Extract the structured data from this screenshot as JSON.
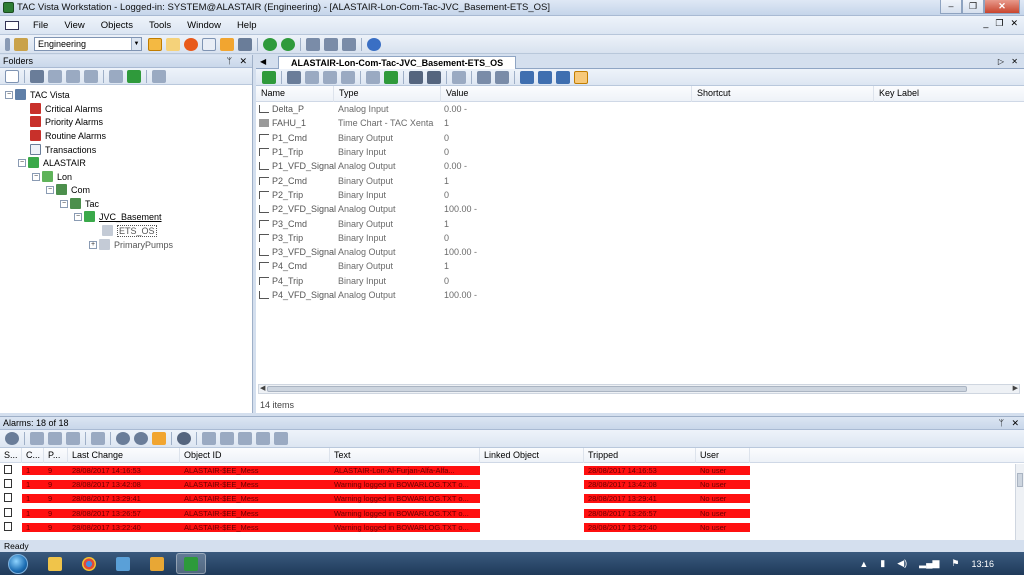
{
  "window": {
    "title": "TAC Vista Workstation - Logged-in: SYSTEM@ALASTAIR (Engineering) - [ALASTAIR-Lon-Com-Tac-JVC_Basement-ETS_OS]",
    "minimize_glyph": "–",
    "restore_glyph": "❐",
    "close_glyph": "✕"
  },
  "menu": {
    "items": [
      "File",
      "View",
      "Objects",
      "Tools",
      "Window",
      "Help"
    ],
    "mdi_minimize": "_",
    "mdi_restore": "❐",
    "mdi_close": "✕"
  },
  "toolbar": {
    "mode_value": "Engineering"
  },
  "folders": {
    "title": "Folders",
    "pin_glyph": "📌",
    "close_glyph": "✕",
    "tree": [
      {
        "label": "TAC Vista",
        "expander": "−"
      },
      {
        "label": "Critical Alarms",
        "expander": ""
      },
      {
        "label": "Priority Alarms",
        "expander": ""
      },
      {
        "label": "Routine Alarms",
        "expander": ""
      },
      {
        "label": "Transactions",
        "expander": ""
      },
      {
        "label": "ALASTAIR",
        "expander": "−"
      },
      {
        "label": "Lon",
        "expander": "−"
      },
      {
        "label": "Com",
        "expander": "−"
      },
      {
        "label": "Tac",
        "expander": "−"
      },
      {
        "label": "JVC_Basement",
        "expander": "−"
      },
      {
        "label": "ETS_OS",
        "expander": ""
      },
      {
        "label": "PrimaryPumps",
        "expander": "+"
      }
    ]
  },
  "document": {
    "tab_label": "ALASTAIR-Lon-Com-Tac-JVC_Basement-ETS_OS",
    "left_arrow": "◀",
    "right_arrow": "▷",
    "close_glyph": "✕",
    "columns": [
      "Name",
      "Type",
      "Value",
      "Shortcut",
      "Key Label"
    ],
    "rows": [
      {
        "name": "Delta_P",
        "type": "Analog Input",
        "value": "0.00 -",
        "icon": "analog-icon"
      },
      {
        "name": "FAHU_1",
        "type": "Time Chart - TAC Xenta",
        "value": "1",
        "icon": "time-chart-icon"
      },
      {
        "name": "P1_Cmd",
        "type": "Binary Output",
        "value": "0",
        "icon": "binary-icon"
      },
      {
        "name": "P1_Trip",
        "type": "Binary Input",
        "value": "0",
        "icon": "binary-icon"
      },
      {
        "name": "P1_VFD_Signal",
        "type": "Analog Output",
        "value": "0.00 -",
        "icon": "analog-icon"
      },
      {
        "name": "P2_Cmd",
        "type": "Binary Output",
        "value": "1",
        "icon": "binary-icon"
      },
      {
        "name": "P2_Trip",
        "type": "Binary Input",
        "value": "0",
        "icon": "binary-icon"
      },
      {
        "name": "P2_VFD_Signal",
        "type": "Analog Output",
        "value": "100.00 -",
        "icon": "analog-icon"
      },
      {
        "name": "P3_Cmd",
        "type": "Binary Output",
        "value": "1",
        "icon": "binary-icon"
      },
      {
        "name": "P3_Trip",
        "type": "Binary Input",
        "value": "0",
        "icon": "binary-icon"
      },
      {
        "name": "P3_VFD_Signal",
        "type": "Analog Output",
        "value": "100.00 -",
        "icon": "analog-icon"
      },
      {
        "name": "P4_Cmd",
        "type": "Binary Output",
        "value": "1",
        "icon": "binary-icon"
      },
      {
        "name": "P4_Trip",
        "type": "Binary Input",
        "value": "0",
        "icon": "binary-icon"
      },
      {
        "name": "P4_VFD_Signal",
        "type": "Analog Output",
        "value": "100.00 -",
        "icon": "analog-icon"
      }
    ],
    "item_count": "14 items"
  },
  "alarms": {
    "title": "Alarms: 18 of 18",
    "pin_glyph": "📌",
    "close_glyph": "✕",
    "columns": [
      "S...",
      "C...",
      "P...",
      "Last Change",
      "Object ID",
      "Text",
      "Linked Object",
      "Tripped",
      "User"
    ],
    "rows": [
      {
        "c": "1",
        "p": "9",
        "last_change": "28/08/2017 14:16:53",
        "object_id": "ALASTAIR-$EE_Mess",
        "text": "ALASTAIR-Lon-Al-Furjan-Alfa-Alfa...",
        "linked": "",
        "tripped": "28/08/2017 14:16:53",
        "user": "No user"
      },
      {
        "c": "1",
        "p": "9",
        "last_change": "28/08/2017 13:42:08",
        "object_id": "ALASTAIR-$EE_Mess",
        "text": "Warning logged in BOWARLOG.TXT o...",
        "linked": "",
        "tripped": "28/08/2017 13:42:08",
        "user": "No user"
      },
      {
        "c": "1",
        "p": "9",
        "last_change": "28/08/2017 13:29:41",
        "object_id": "ALASTAIR-$EE_Mess",
        "text": "Warning logged in BOWARLOG.TXT o...",
        "linked": "",
        "tripped": "28/08/2017 13:29:41",
        "user": "No user"
      },
      {
        "c": "1",
        "p": "9",
        "last_change": "28/08/2017 13:26:57",
        "object_id": "ALASTAIR-$EE_Mess",
        "text": "Warning logged in BOWARLOG.TXT o...",
        "linked": "",
        "tripped": "28/08/2017 13:26:57",
        "user": "No user"
      },
      {
        "c": "1",
        "p": "9",
        "last_change": "28/08/2017 13:22:40",
        "object_id": "ALASTAIR-$EE_Mess",
        "text": "Warning logged in BOWARLOG.TXT o...",
        "linked": "",
        "tripped": "28/08/2017 13:22:40",
        "user": "No user"
      }
    ]
  },
  "status": {
    "text": "Ready"
  },
  "taskbar": {
    "clock": "13:16"
  },
  "colors": {
    "alarm_row": "#ff1010",
    "chrome": "#d4dfee"
  }
}
